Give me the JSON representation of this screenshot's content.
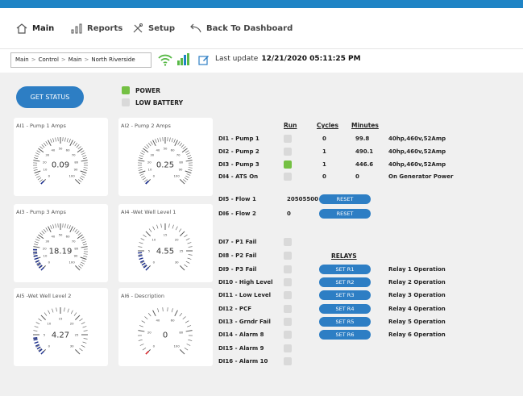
{
  "nav": {
    "main": "Main",
    "reports": "Reports",
    "setup": "Setup",
    "back": "Back To Dashboard"
  },
  "breadcrumb": [
    "Main",
    "Control",
    "Main",
    "North Riverside"
  ],
  "last_update": {
    "label": "Last update",
    "value": "12/21/2020 05:11:25 PM"
  },
  "get_status": "GET STATUS",
  "legend": {
    "power": "POWER",
    "low_battery": "LOW BATTERY",
    "power_color": "#74c043",
    "low_battery_color": "#d9d9d9"
  },
  "gauges": [
    {
      "title": "AI1 - Pump 1 Amps",
      "value": "0.09",
      "ticks": [
        "0",
        "10",
        "20",
        "30",
        "40",
        "50",
        "60",
        "70",
        "80",
        "90",
        "100"
      ],
      "needle_color": "#1c2f8e"
    },
    {
      "title": "AI2 - Pump 2 Amps",
      "value": "0.25",
      "ticks": [
        "0",
        "10",
        "20",
        "30",
        "40",
        "50",
        "60",
        "70",
        "80",
        "90",
        "100"
      ],
      "needle_color": "#1c2f8e"
    },
    {
      "title": "AI3 - Pump 3 Amps",
      "value": "18.19",
      "ticks": [
        "0",
        "10",
        "20",
        "30",
        "40",
        "50",
        "60",
        "70",
        "80",
        "90",
        "100"
      ],
      "needle_color": "#1c2f8e"
    },
    {
      "title": "AI4 -Wet Well Level 1",
      "value": "4.55",
      "ticks": [
        "0",
        "5",
        "10",
        "15",
        "20",
        "25",
        "30"
      ],
      "needle_color": "#1c2f8e"
    },
    {
      "title": "AI5 -Wet Well Level 2",
      "value": "4.27",
      "ticks": [
        "0",
        "5",
        "10",
        "15",
        "20",
        "25",
        "30"
      ],
      "needle_color": "#1c2f8e"
    },
    {
      "title": "AI6 - Description",
      "value": "0",
      "ticks": [
        "0",
        "20",
        "40",
        "60",
        "80",
        "100"
      ],
      "needle_color": "#d8262b"
    }
  ],
  "gauge_levels": [
    0.0009,
    0.0025,
    0.18,
    0.15,
    0.14,
    0.0
  ],
  "columns": {
    "run": "Run",
    "cycles": "Cycles",
    "minutes": "Minutes"
  },
  "pumps": [
    {
      "label": "DI1 - Pump 1",
      "run": false,
      "cycles": "0",
      "minutes": "99.8",
      "desc": "40hp,460v,52Amp"
    },
    {
      "label": "DI2 - Pump 2",
      "run": false,
      "cycles": "1",
      "minutes": "490.1",
      "desc": "40hp,460v,52Amp"
    },
    {
      "label": "DI3 - Pump 3",
      "run": true,
      "cycles": "1",
      "minutes": "446.6",
      "desc": "40hp,460v,52Amp"
    },
    {
      "label": "DI4 - ATS On",
      "run": false,
      "cycles": "0",
      "minutes": "0",
      "desc": "On Generator Power"
    }
  ],
  "flows": [
    {
      "label": "DI5 - Flow 1",
      "value": "20505500",
      "button": "RESET"
    },
    {
      "label": "DI6 - Flow 2",
      "value": "0",
      "button": "RESET"
    }
  ],
  "relays_header": "RELAYS",
  "faults": [
    {
      "label": "DI7 - P1 Fail"
    },
    {
      "label": "DI8 - P2 Fail"
    },
    {
      "label": "DI9 - P3 Fail",
      "button": "SET R1",
      "relay": "Relay 1 Operation"
    },
    {
      "label": "DI10 - High Level",
      "button": "SET R2",
      "relay": "Relay 2 Operation"
    },
    {
      "label": "DI11 - Low Level",
      "button": "SET R3",
      "relay": "Relay 3 Operation"
    },
    {
      "label": "DI12 - PCF",
      "button": "SET R4",
      "relay": "Relay 4 Operation"
    },
    {
      "label": "DI13 - Grndr Fail",
      "button": "SET R5",
      "relay": "Relay 5 Operation"
    },
    {
      "label": "DI14 - Alarm 8",
      "button": "SET R6",
      "relay": "Relay 6 Operation"
    },
    {
      "label": "DI15 - Alarm 9"
    },
    {
      "label": "DI16 - Alarm 10"
    }
  ],
  "colors": {
    "accent": "#1f84c5",
    "button": "#2d7ec4",
    "run_on": "#74c043",
    "indicator_off": "#d9d9d9"
  }
}
